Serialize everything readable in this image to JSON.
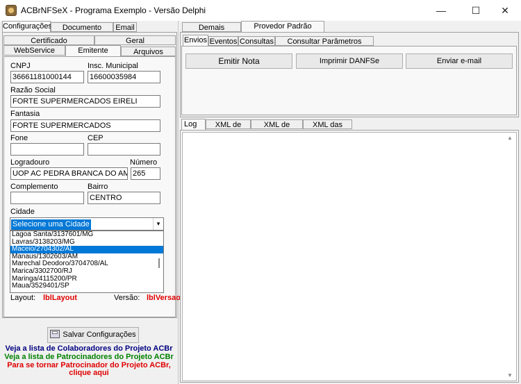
{
  "window": {
    "title": "ACBrNFSeX - Programa Exemplo - Versão Delphi",
    "minimize": "—",
    "maximize": "☐",
    "close": "✕"
  },
  "left": {
    "tabs_top": [
      "Configurações",
      "Documento Auxiliar",
      "Email"
    ],
    "tabs_row1": [
      "Certificado",
      "Geral"
    ],
    "tabs_row2": [
      "WebService",
      "Emitente",
      "Arquivos"
    ],
    "form": {
      "cnpj_label": "CNPJ",
      "cnpj_value": "36661181000144",
      "insc_label": "Insc. Municipal",
      "insc_value": "16600035984",
      "razao_label": "Razão Social",
      "razao_value": "FORTE SUPERMERCADOS EIRELI",
      "fantasia_label": "Fantasia",
      "fantasia_value": "FORTE SUPERMERCADOS",
      "fone_label": "Fone",
      "fone_value": "",
      "cep_label": "CEP",
      "cep_value": "",
      "logradouro_label": "Logradouro",
      "logradouro_value": "UOP AC PEDRA BRANCA DO AMAPARI - ",
      "numero_label": "Número",
      "numero_value": "265",
      "complemento_label": "Complemento",
      "complemento_value": "",
      "bairro_label": "Bairro",
      "bairro_value": "CENTRO",
      "cidade_label": "Cidade",
      "cidade_value": "Selecione uma Cidade",
      "cidade_options": [
        {
          "text": "Lagoa Santa/3137601/MG",
          "selected": false
        },
        {
          "text": "Lavras/3138203/MG",
          "selected": false
        },
        {
          "text": "Maceio/2704302/AL",
          "selected": true
        },
        {
          "text": "Manaus/1302603/AM",
          "selected": false
        },
        {
          "text": "Marechal Deodoro/3704708/AL",
          "selected": false
        },
        {
          "text": "Marica/3302700/RJ",
          "selected": false
        },
        {
          "text": "Maringa/4115200/PR",
          "selected": false
        },
        {
          "text": "Maua/3529401/SP",
          "selected": false
        }
      ],
      "layout_label": "Layout:",
      "layout_value": "lblLayout",
      "versao_label": "Versão:",
      "versao_value": "lblVersao"
    },
    "save_button": "Salvar Configurações",
    "links": {
      "colaboradores": "Veja a lista de Colaboradores do Projeto ACBr",
      "patrocinadores": "Veja a lista de Patrocinadores do Projeto ACBr",
      "patrocinador1": "Para se tornar Patrocinador do Projeto ACBr,",
      "patrocinador2": "clique aqui"
    },
    "colors": {
      "colaboradores": "#000080",
      "patrocinadores": "#008000",
      "patrocinador": "#e00000"
    }
  },
  "right": {
    "tabs_top": [
      "Demais Provedores",
      "Provedor Padrão Nacional"
    ],
    "tabs_second": [
      "Envios",
      "Eventos",
      "Consultas",
      "Consultar Parâmetros Municipais"
    ],
    "buttons": [
      "Emitir Nota",
      "Imprimir DANFSe",
      "Enviar e-mail"
    ],
    "log_tabs": [
      "Log",
      "XML de Envio",
      "XML de Retorno",
      "XML das Notas"
    ]
  }
}
